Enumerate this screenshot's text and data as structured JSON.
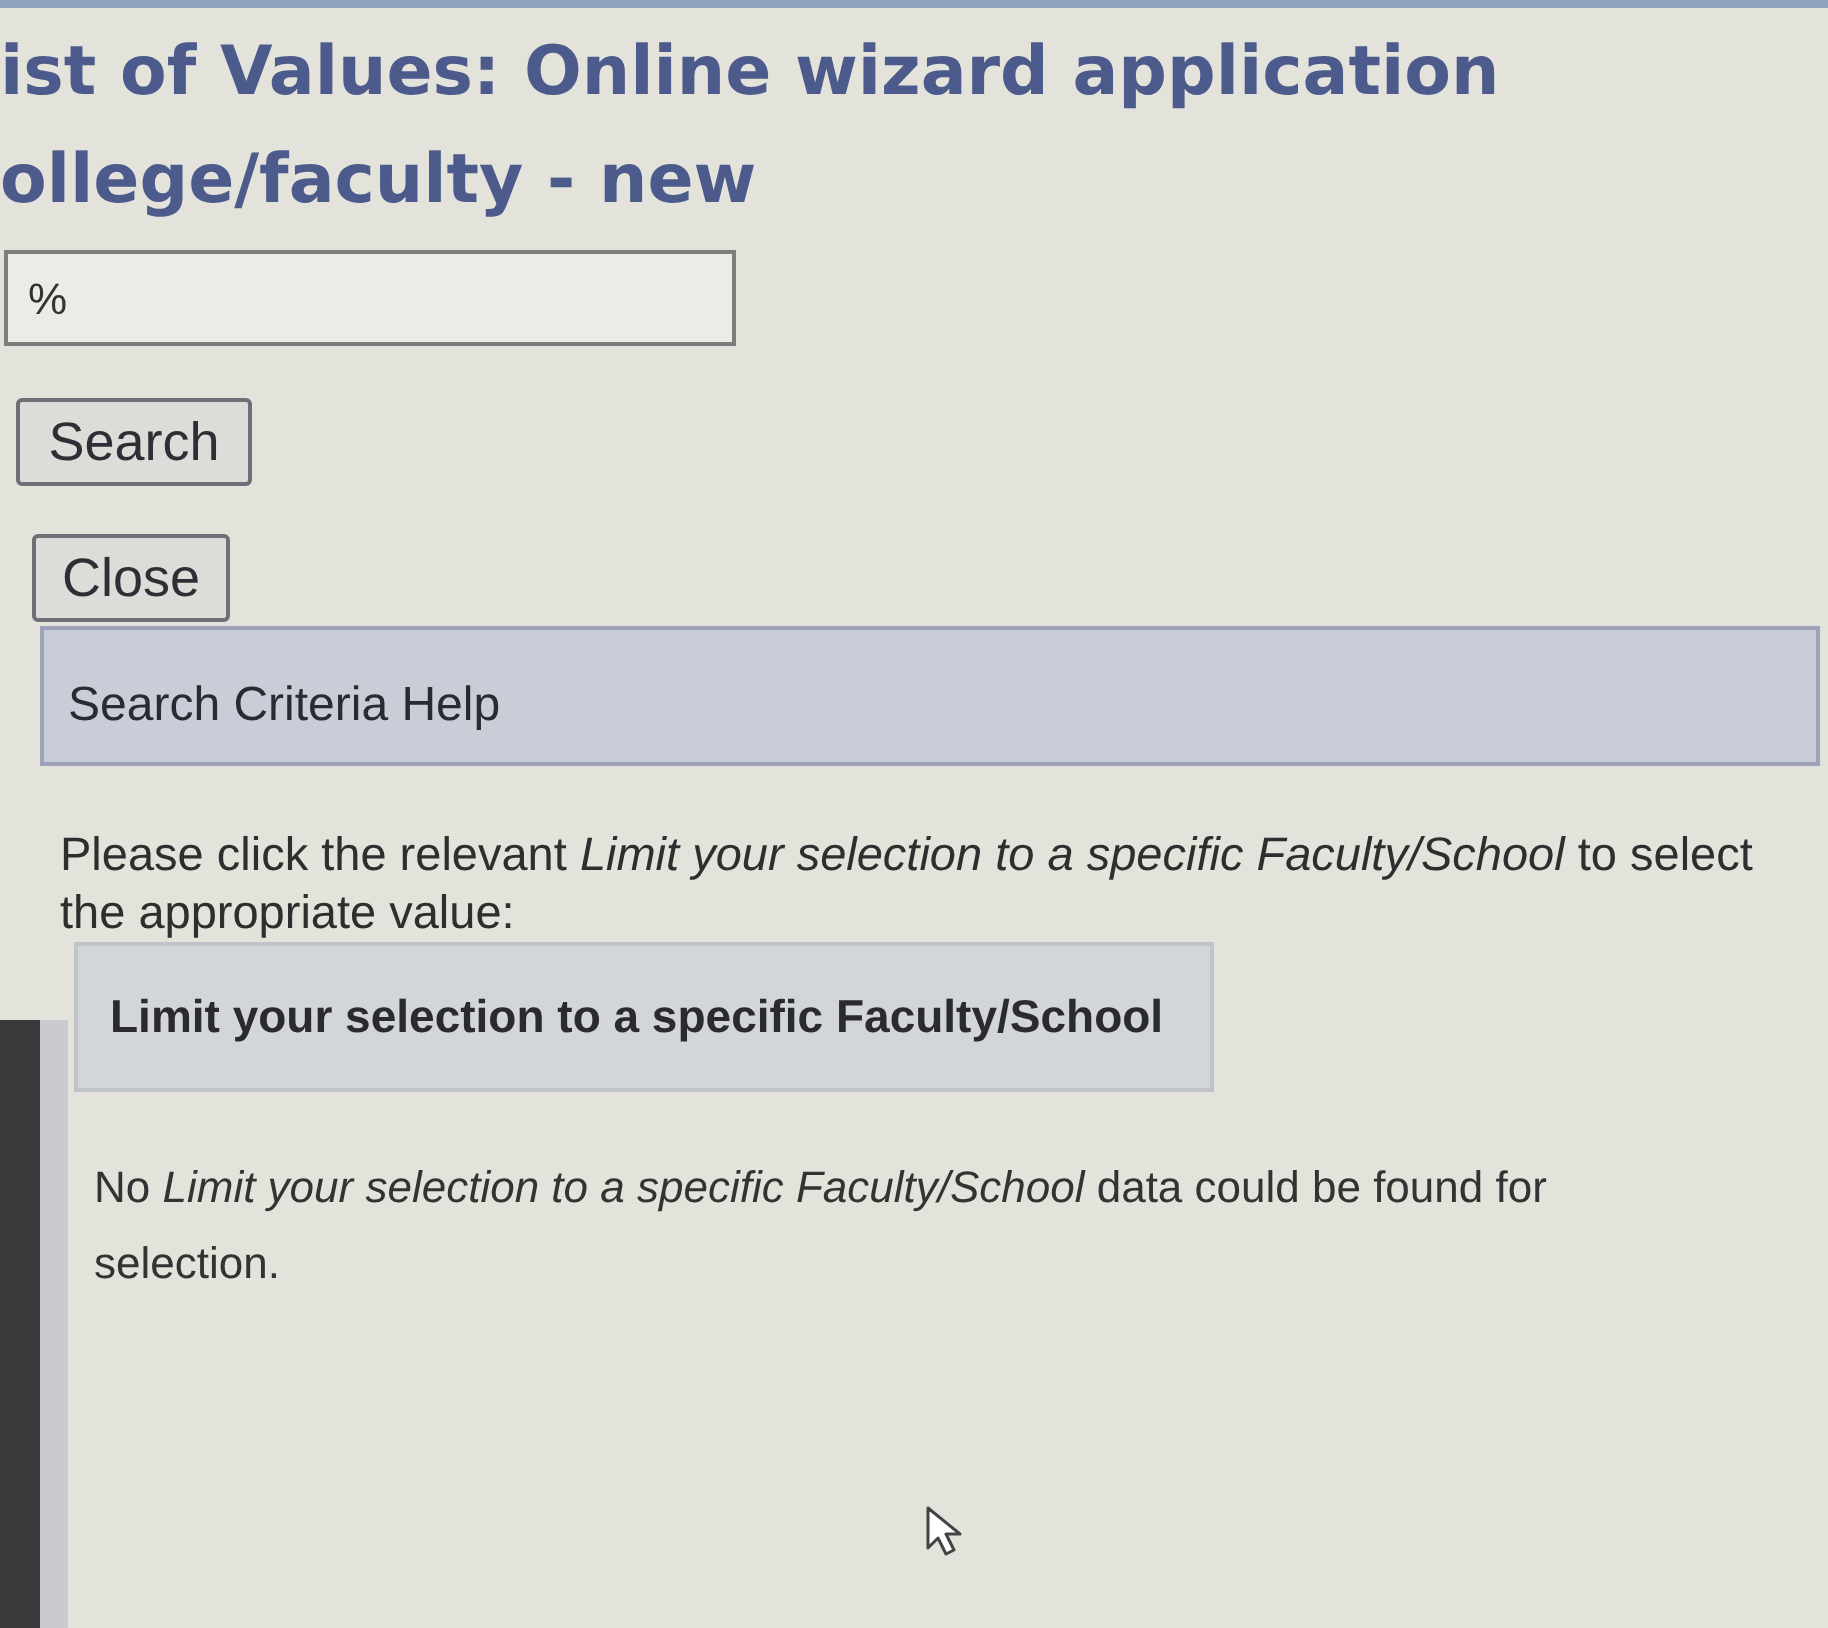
{
  "window": {
    "title_lines": [
      "ist of Values: Online wizard application",
      "ollege/faculty - new"
    ]
  },
  "search_field": {
    "value": "%"
  },
  "buttons": [
    "Search",
    "Close"
  ],
  "help_bar": {
    "label": "Search Criteria Help"
  },
  "instructions": "Please click the relevant *Limit your selection to a specific Faculty/School* to select the appropriate value:",
  "filter_link": {
    "label": "Limit your selection to a specific Faculty/School"
  },
  "message": "No *Limit your selection to a specific Faculty/School* data could be found for selection."
}
